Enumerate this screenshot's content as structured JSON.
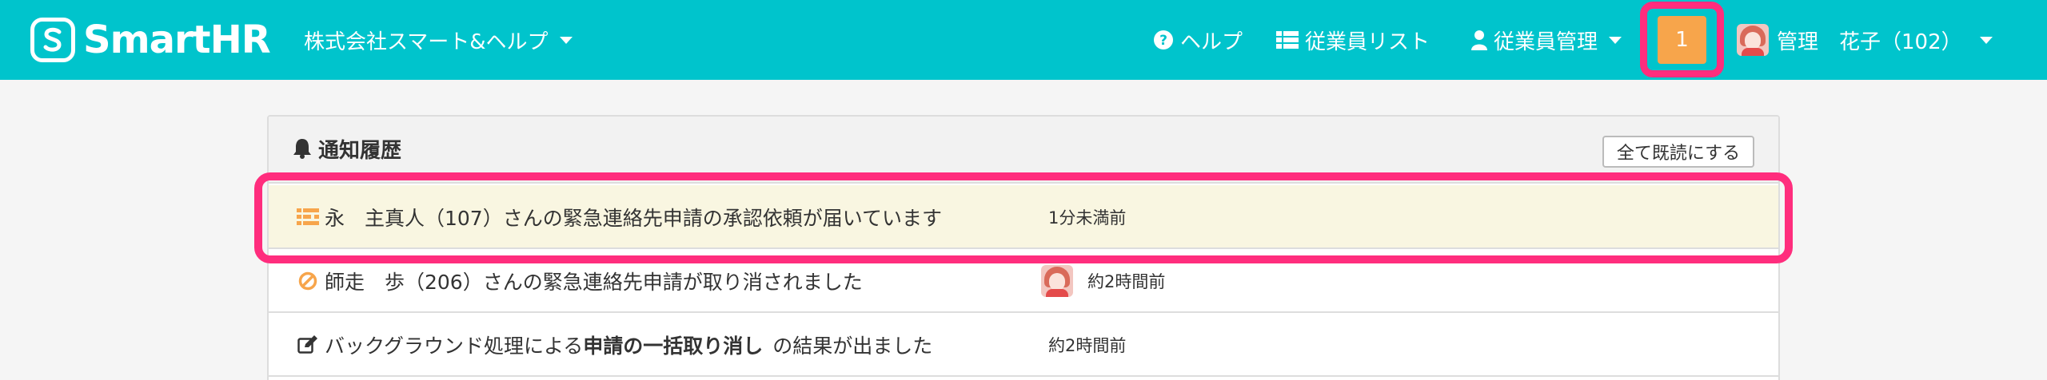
{
  "header": {
    "logo_text": "SmartHR",
    "company_name": "株式会社スマート&ヘルプ",
    "nav": {
      "help_label": "ヘルプ",
      "employee_list_label": "従業員リスト",
      "employee_mgmt_label": "従業員管理"
    },
    "notification_count": "1",
    "user_name": "管理　花子（102）"
  },
  "panel": {
    "title": "通知履歴",
    "mark_all_read_label": "全て既読にする",
    "rows": [
      {
        "icon": "request-list-icon",
        "text": "永　主真人（107）さんの緊急連絡先申請の承認依頼が届いています",
        "time": "1分未満前",
        "unread": true
      },
      {
        "icon": "cancel-circle-icon",
        "text": "師走　歩（206）さんの緊急連絡先申請が取り消されました",
        "time": "約2時間前",
        "has_avatar": true
      },
      {
        "icon": "edit-icon",
        "text_before": "バックグラウンド処理による",
        "text_bold": "申請の一括取り消し",
        "text_after": "の結果が出ました",
        "time": "約2時間前"
      }
    ]
  },
  "colors": {
    "header_bg": "#00c4cc",
    "highlight": "#ff2d7d",
    "badge": "#f7a54b",
    "unread_row_bg": "#f9f6e1",
    "icon_orange": "#f7a54b"
  }
}
